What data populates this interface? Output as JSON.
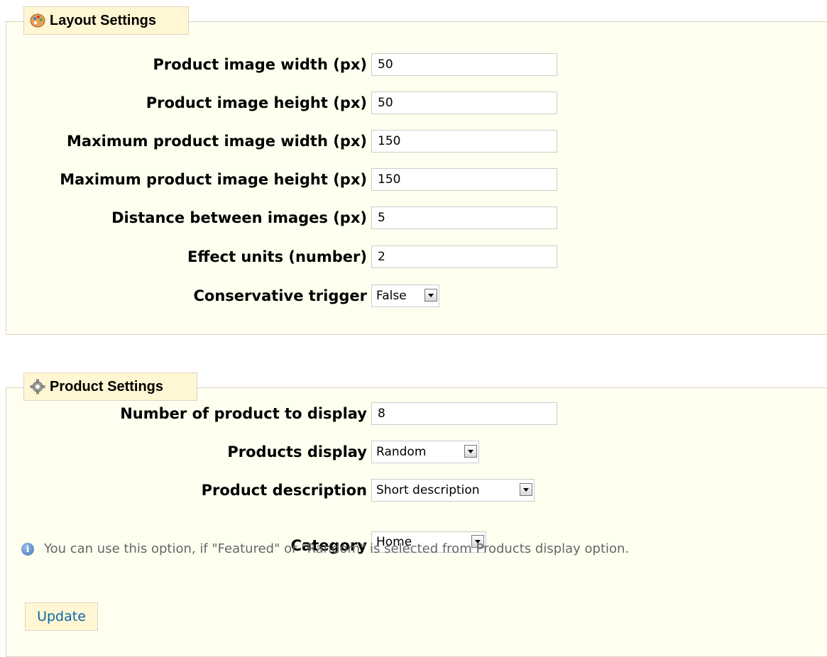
{
  "layout_settings": {
    "legend": "Layout Settings",
    "icon": "palette-icon",
    "fields": [
      {
        "label": "Product image width (px)",
        "value": "50"
      },
      {
        "label": "Product image height (px)",
        "value": "50"
      },
      {
        "label": "Maximum product image width (px)",
        "value": "150"
      },
      {
        "label": "Maximum product image height (px)",
        "value": "150"
      },
      {
        "label": "Distance between images (px)",
        "value": "5"
      },
      {
        "label": "Effect units (number)",
        "value": "2"
      }
    ],
    "conservative_trigger": {
      "label": "Conservative trigger",
      "selected": "False"
    }
  },
  "product_settings": {
    "legend": "Product Settings",
    "icon": "gear-icon",
    "number_of_products": {
      "label": "Number of product to display",
      "value": "8"
    },
    "products_display": {
      "label": "Products display",
      "selected": "Random"
    },
    "product_description": {
      "label": "Product description",
      "selected": "Short description"
    },
    "category": {
      "label": "Category",
      "selected": "Home"
    },
    "info": "You can use this option, if \"Featured\" or \"Random\" is selected from Products display option.",
    "update_label": "Update"
  },
  "colors": {
    "panel_bg": "#fffff0",
    "legend_bg": "#fff6d3",
    "border": "#dfd5c3",
    "link": "#0b67a8"
  }
}
